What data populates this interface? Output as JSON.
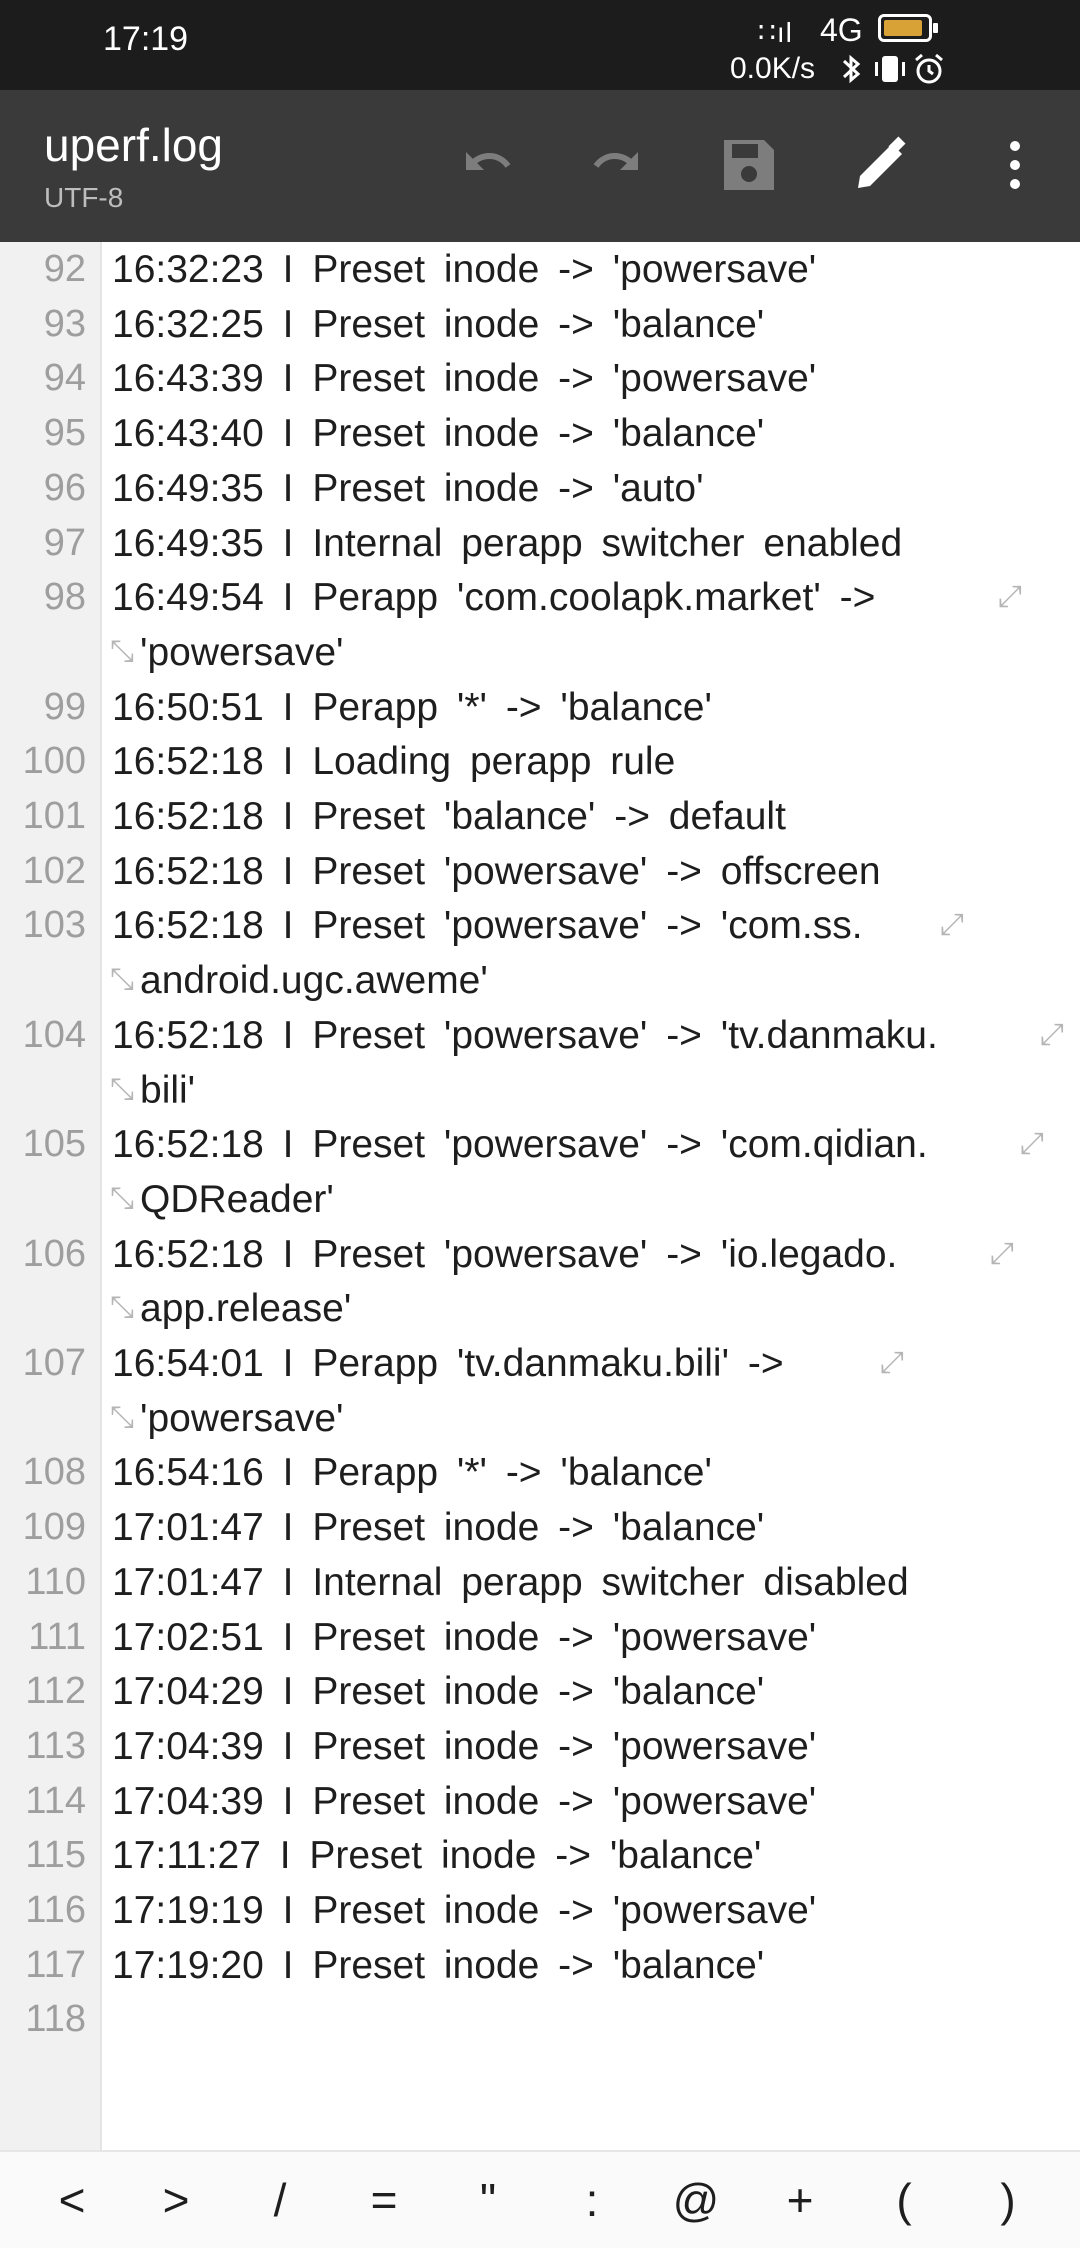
{
  "status_bar": {
    "time": "17:19",
    "network": "4G",
    "signal_glyph": "∷ıl",
    "speed": "0.0K/s",
    "icons": [
      "bluetooth-icon",
      "vibrate-icon",
      "alarm-icon"
    ],
    "battery_color": "#d9a236"
  },
  "toolbar": {
    "title": "uperf.log",
    "encoding": "UTF-8",
    "actions": [
      "undo-icon",
      "redo-icon",
      "save-icon",
      "edit-icon",
      "more-icon"
    ]
  },
  "lines": [
    {
      "n": "92",
      "t": "16:32:23 I Preset inode -> 'powersave'"
    },
    {
      "n": "93",
      "t": "16:32:25 I Preset inode -> 'balance'"
    },
    {
      "n": "94",
      "t": "16:43:39 I Preset inode -> 'powersave'"
    },
    {
      "n": "95",
      "t": "16:43:40 I Preset inode -> 'balance'"
    },
    {
      "n": "96",
      "t": "16:49:35 I Preset inode -> 'auto'"
    },
    {
      "n": "97",
      "t": "16:49:35 I Internal perapp switcher enabled"
    },
    {
      "n": "98",
      "t": "16:49:54 I Perapp 'com.coolapk.market' ->"
    },
    {
      "n": "",
      "t": "'powersave'"
    },
    {
      "n": "99",
      "t": "16:50:51 I Perapp '*' -> 'balance'"
    },
    {
      "n": "100",
      "t": "16:52:18 I Loading perapp rule"
    },
    {
      "n": "101",
      "t": "16:52:18 I Preset 'balance' -> default"
    },
    {
      "n": "102",
      "t": "16:52:18 I Preset 'powersave' -> offscreen"
    },
    {
      "n": "103",
      "t": "16:52:18 I Preset 'powersave' -> 'com.ss."
    },
    {
      "n": "",
      "t": "android.ugc.aweme'"
    },
    {
      "n": "104",
      "t": "16:52:18 I Preset 'powersave' -> 'tv.danmaku."
    },
    {
      "n": "",
      "t": "bili'"
    },
    {
      "n": "105",
      "t": "16:52:18 I Preset 'powersave' -> 'com.qidian."
    },
    {
      "n": "",
      "t": "QDReader'"
    },
    {
      "n": "106",
      "t": "16:52:18 I Preset 'powersave' -> 'io.legado."
    },
    {
      "n": "",
      "t": "app.release'"
    },
    {
      "n": "107",
      "t": "16:54:01 I Perapp 'tv.danmaku.bili' ->"
    },
    {
      "n": "",
      "t": "'powersave'"
    },
    {
      "n": "108",
      "t": "16:54:16 I Perapp '*' -> 'balance'"
    },
    {
      "n": "109",
      "t": "17:01:47 I Preset inode -> 'balance'"
    },
    {
      "n": "110",
      "t": "17:01:47 I Internal perapp switcher disabled"
    },
    {
      "n": "111",
      "t": "17:02:51 I Preset inode -> 'powersave'"
    },
    {
      "n": "112",
      "t": "17:04:29 I Preset inode -> 'balance'"
    },
    {
      "n": "113",
      "t": "17:04:39 I Preset inode -> 'powersave'"
    },
    {
      "n": "114",
      "t": "17:04:39 I Preset inode -> 'powersave'"
    },
    {
      "n": "115",
      "t": "17:11:27 I Preset inode -> 'balance'"
    },
    {
      "n": "116",
      "t": "17:19:19 I Preset inode -> 'powersave'"
    },
    {
      "n": "117",
      "t": "17:19:20 I Preset inode -> 'balance'"
    },
    {
      "n": "118",
      "t": ""
    }
  ],
  "wrap_glyphs": {
    "end": "⤢",
    "start": "⤡"
  },
  "symbols": [
    "<",
    ">",
    "/",
    "=",
    "\"",
    ":",
    "@",
    "+",
    "(",
    ")"
  ]
}
